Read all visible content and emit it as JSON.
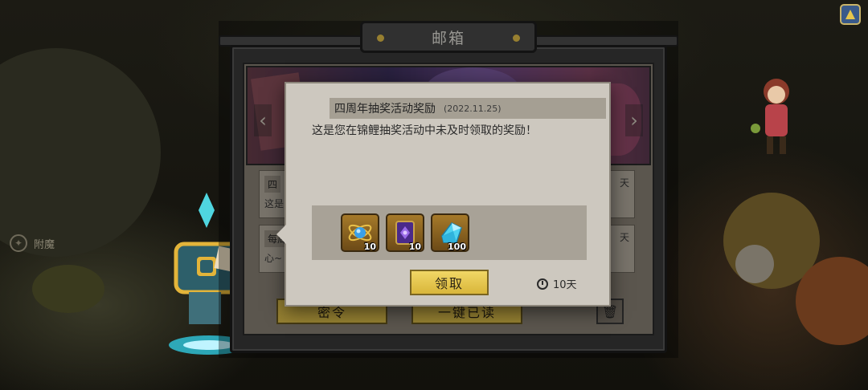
{
  "side_menu": {
    "enchant_label": "附魔"
  },
  "mailbox": {
    "title": "邮箱",
    "items": [
      {
        "title": "四",
        "preview": "这是",
        "tag": "天"
      },
      {
        "title": "每周",
        "preview": "心~",
        "tag": "天"
      }
    ],
    "buttons": {
      "password": "密令",
      "read_all": "一键已读"
    }
  },
  "popup": {
    "title": "四周年抽奖活动奖励",
    "date": "(2022.11.25)",
    "body": "这是您在锦鲤抽奖活动中未及时领取的奖励！",
    "rewards": [
      {
        "icon": "orbit-gem-icon",
        "qty": "10"
      },
      {
        "icon": "purple-rune-book-icon",
        "qty": "10"
      },
      {
        "icon": "blue-crystal-icon",
        "qty": "100"
      }
    ],
    "claim_label": "领取",
    "expiry": "10天"
  },
  "colors": {
    "accent": "#e6c64d",
    "panel": "#cdc8bf",
    "frame": "#3b3b3b"
  }
}
